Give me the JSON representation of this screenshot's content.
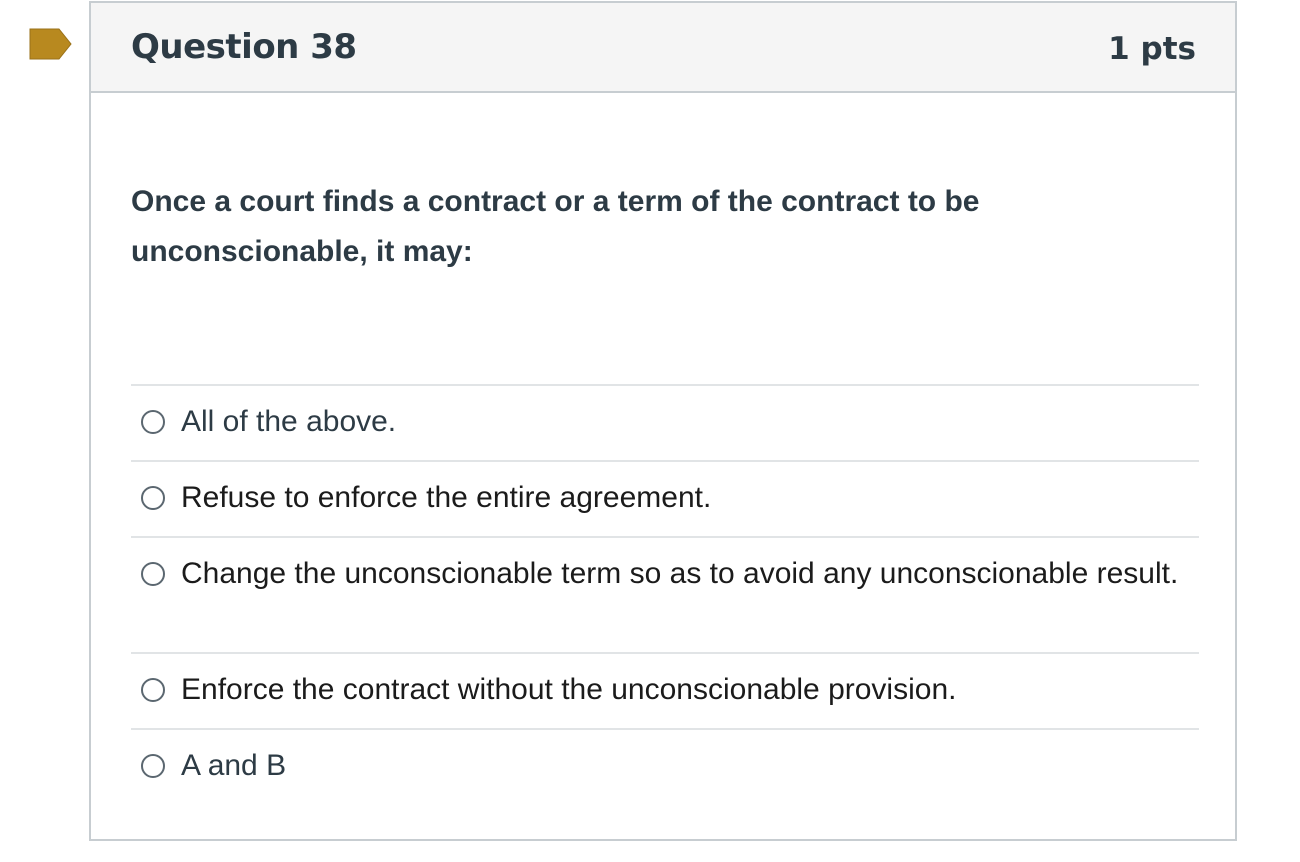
{
  "question": {
    "title": "Question 38",
    "points": "1 pts",
    "text": "Once a court finds a contract or a term of the contract to be unconscionable, it may:",
    "flag_icon": "flag-marker-icon",
    "flag_color": "#b8891f"
  },
  "answers": [
    {
      "label": "All of the above.",
      "selected": false
    },
    {
      "label": "Refuse to enforce the entire agreement.",
      "selected": false
    },
    {
      "label": "Change the unconscionable term so as to avoid any unconscionable result.",
      "selected": false
    },
    {
      "label": "Enforce the contract without the unconscionable provision.",
      "selected": false
    },
    {
      "label": "A and B",
      "selected": false
    }
  ]
}
